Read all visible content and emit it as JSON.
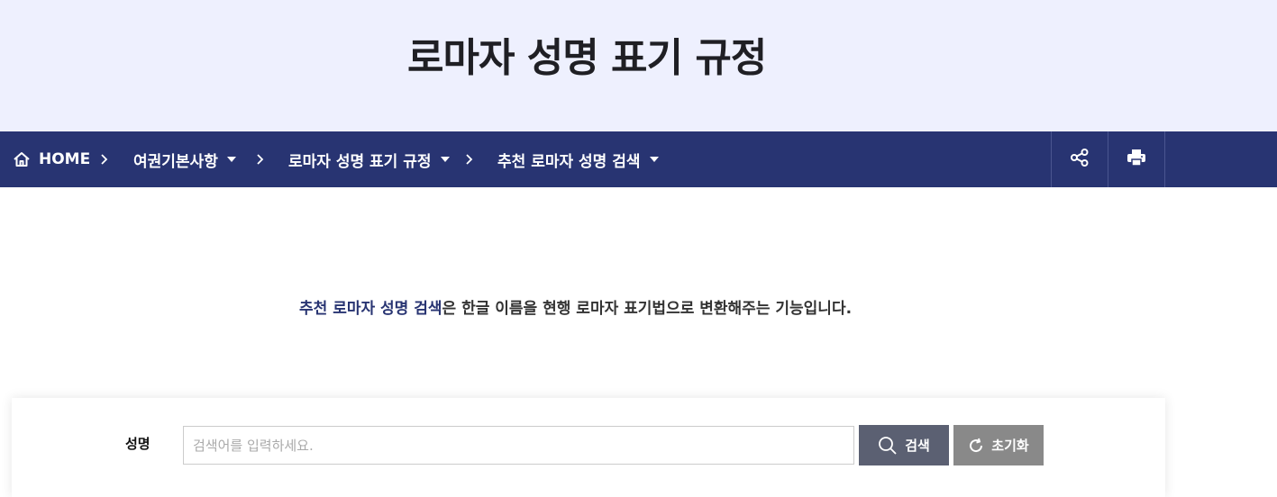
{
  "header": {
    "title": "로마자 성명 표기 규정"
  },
  "nav": {
    "home_label": "HOME",
    "crumbs": [
      {
        "label": "여권기본사항"
      },
      {
        "label": "로마자 성명 표기 규정"
      },
      {
        "label": "추천 로마자 성명 검색"
      }
    ],
    "separator": ">",
    "tools": [
      "share-icon",
      "print-icon"
    ]
  },
  "intro": {
    "highlight": "추천 로마자 성명 검색",
    "rest": "은 한글 이름을 현행 로마자 표기법으로 변환해주는 기능입니다."
  },
  "search": {
    "label": "성명",
    "placeholder": "검색어를 입력하세요.",
    "value": "",
    "search_button": "검색",
    "reset_button": "초기화"
  },
  "colors": {
    "header_bg": "#eef0fe",
    "nav_bg": "#283472",
    "search_button_bg": "#5b6072",
    "reset_button_bg": "#898989",
    "highlight_text": "#283472"
  }
}
